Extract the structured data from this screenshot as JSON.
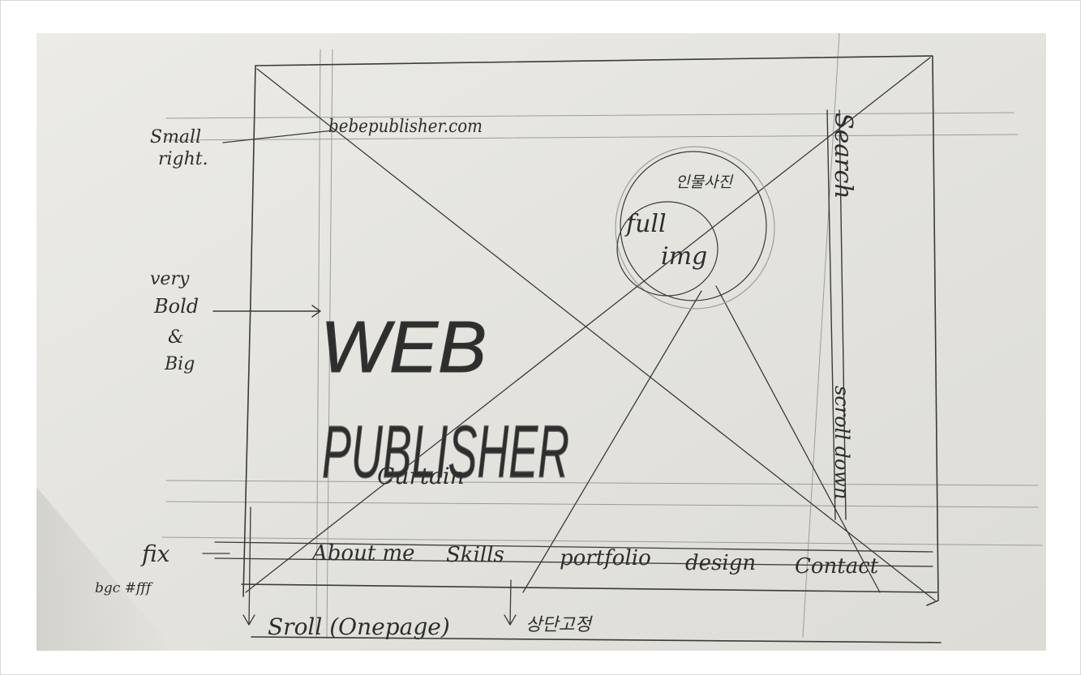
{
  "sketch": {
    "logo_text": "bebepublisher.com",
    "hero_lines": [
      "WEB",
      "PUBLISHER"
    ],
    "hero_subtext": "Curtain",
    "hero_image": [
      "full",
      "img"
    ],
    "hero_image_annotation": "인물사진",
    "search_text": "Search",
    "scroll_indicator": "scroll down",
    "nav_items": [
      "About me",
      "Skills",
      "portfolio",
      "design",
      "Contact"
    ],
    "notes": {
      "logo": [
        "Small",
        "right."
      ],
      "hero": [
        "very",
        "Bold",
        "&",
        "Big"
      ],
      "nav": [
        "fix",
        "bgc #fff"
      ],
      "scroll": "Sroll (Onepage)",
      "footer": "상단고정"
    }
  }
}
